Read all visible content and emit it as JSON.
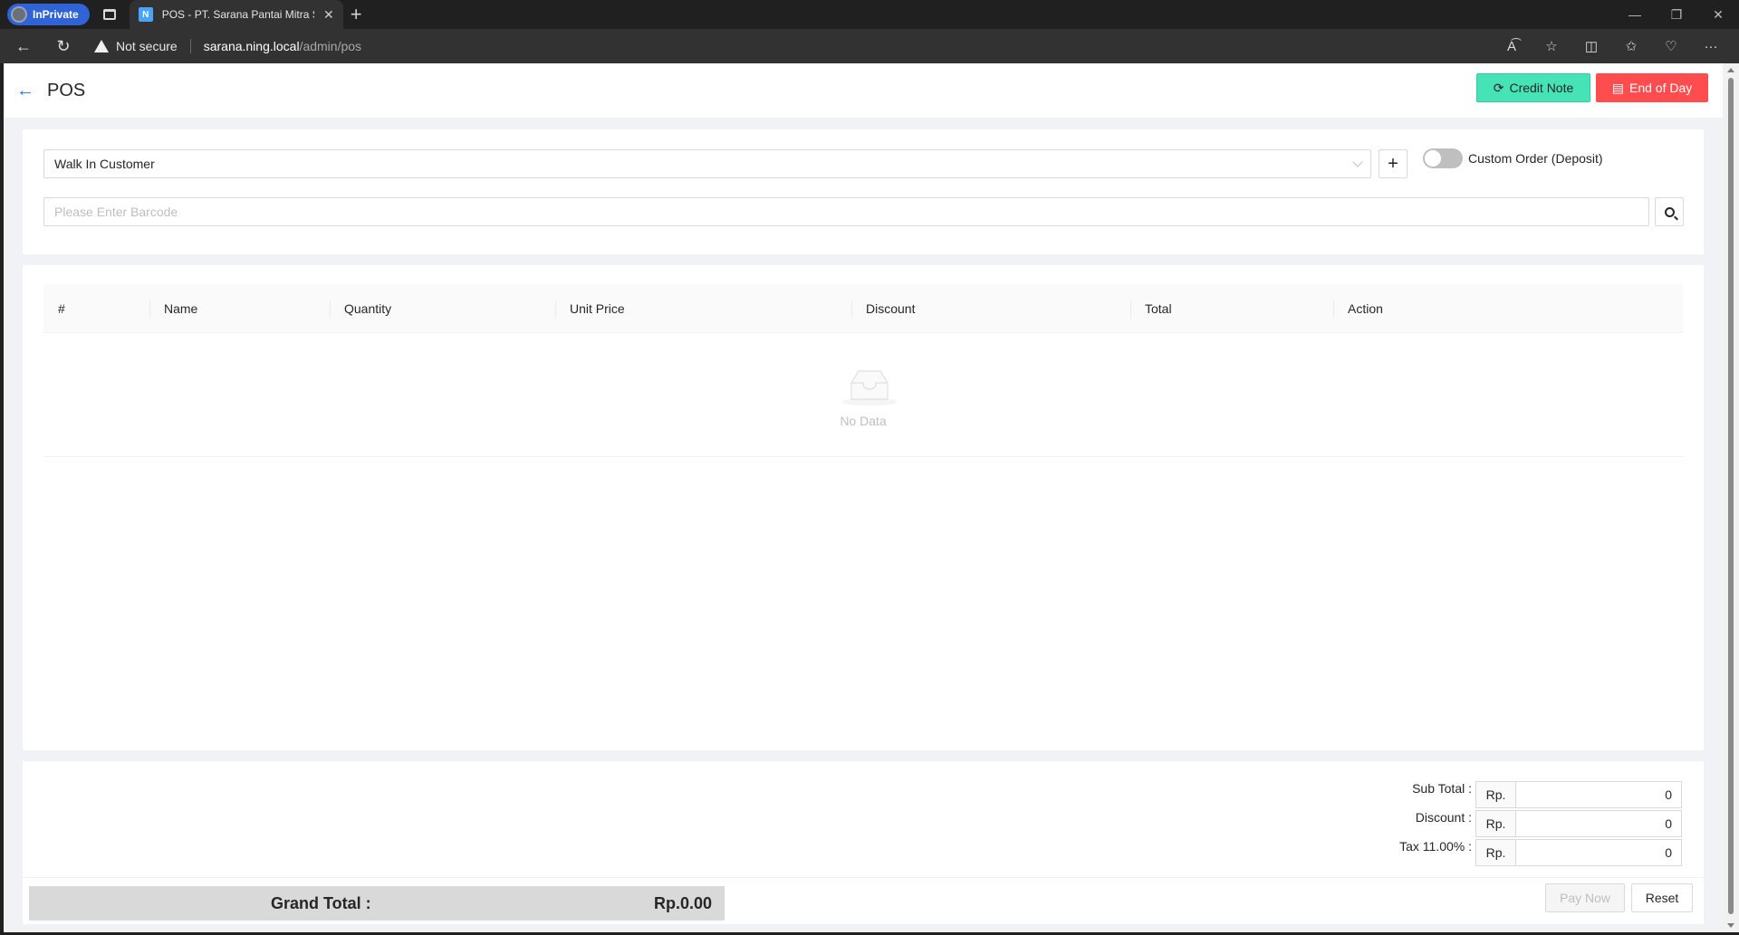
{
  "browser": {
    "inprivate_label": "InPrivate",
    "tab_title": "POS - PT. Sarana Pantai Mitra Se",
    "security_label": "Not secure",
    "url_host": "sarana.ning.local",
    "url_path": "/admin/pos"
  },
  "page": {
    "title": "POS",
    "credit_note_label": "Credit Note",
    "end_of_day_label": "End of Day"
  },
  "order": {
    "customer_value": "Walk In Customer",
    "custom_order_label": "Custom Order (Deposit)",
    "custom_order_enabled": false,
    "barcode_placeholder": "Please Enter Barcode"
  },
  "table": {
    "columns": [
      "#",
      "Name",
      "Quantity",
      "Unit Price",
      "Discount",
      "Total",
      "Action"
    ],
    "rows": [],
    "empty_text": "No Data"
  },
  "summary": {
    "currency_prefix": "Rp.",
    "sub_total_label": "Sub Total :",
    "sub_total_value": "0",
    "discount_label": "Discount :",
    "discount_value": "0",
    "tax_label": "Tax 11.00% :",
    "tax_value": "0",
    "grand_total_label": "Grand Total :",
    "grand_total_value": "Rp.0.00",
    "pay_now_label": "Pay Now",
    "reset_label": "Reset"
  },
  "colors": {
    "credit_note_bg": "#46e3b7",
    "end_of_day_bg": "#ff4d4f",
    "primary": "#1677ff"
  }
}
